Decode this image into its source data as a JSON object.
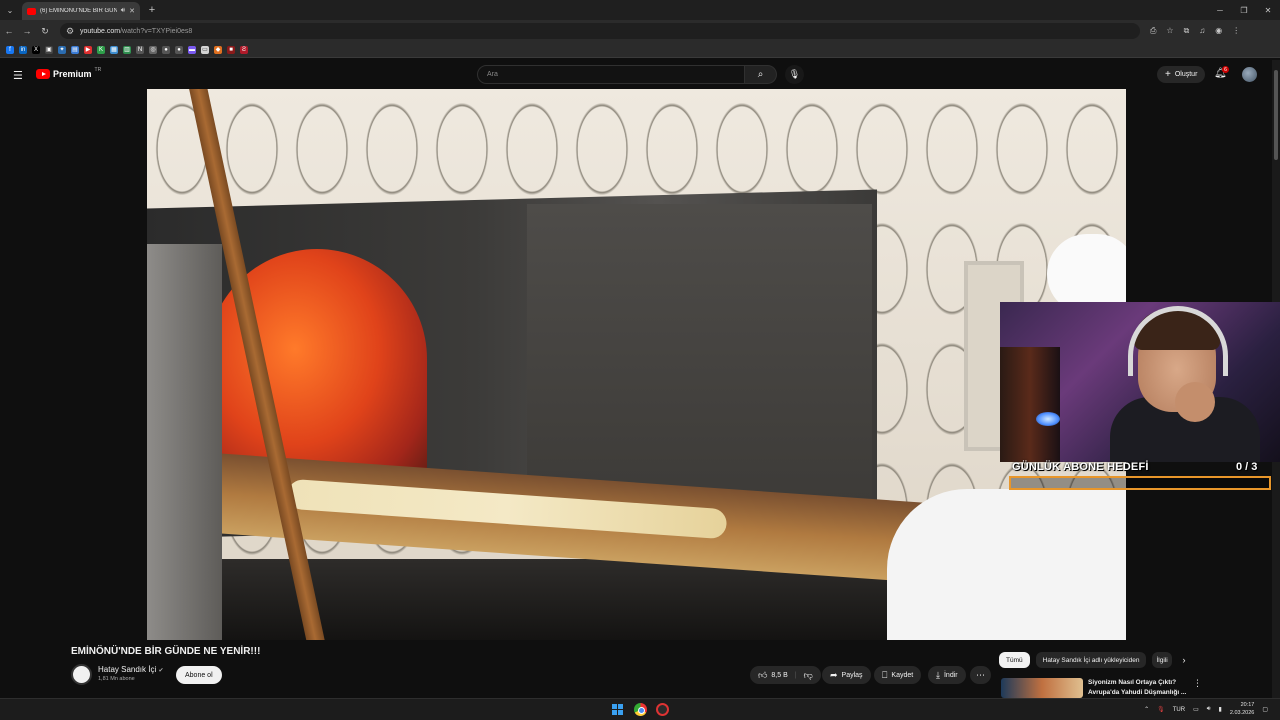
{
  "browser": {
    "tab_title": "(6) EMİNÖNÜ'NDE BİR GÜNDE NE YENİR!!!",
    "url_host": "youtube.com",
    "url_path": "/watch?v=TXYPiei0es8"
  },
  "youtube": {
    "logo_text": "Premium",
    "logo_sup": "TR",
    "search_placeholder": "Ara",
    "create_label": "Oluştur",
    "notification_count": "6"
  },
  "overlay": {
    "goal_label": "GÜNLÜK ABONE HEDEFİ",
    "goal_count": "0  / 3",
    "goal_progress": 0
  },
  "video": {
    "title": "EMİNÖNÜ'NDE BİR GÜNDE NE YENİR!!!",
    "channel_name": "Hatay Sandık İçi",
    "subscribers": "1,81 Mn abone",
    "subscribe_label": "Abone ol",
    "likes": "8,5 B",
    "share_label": "Paylaş",
    "save_label": "Kaydet",
    "download_label": "İndir"
  },
  "sidebar": {
    "chips": [
      "Tümü",
      "Hatay Sandık İçi adlı yükleyiciden",
      "İlgili"
    ],
    "rec_title": "Siyonizm Nasıl Ortaya Çıktı? Avrupa'da Yahudi Düşmanlığı ..."
  },
  "taskbar": {
    "lang": "TUR",
    "time": "20:17",
    "date": "2.03.2026"
  },
  "colors": {
    "yt_red": "#ff0000",
    "goal_border": "#e8962a"
  }
}
